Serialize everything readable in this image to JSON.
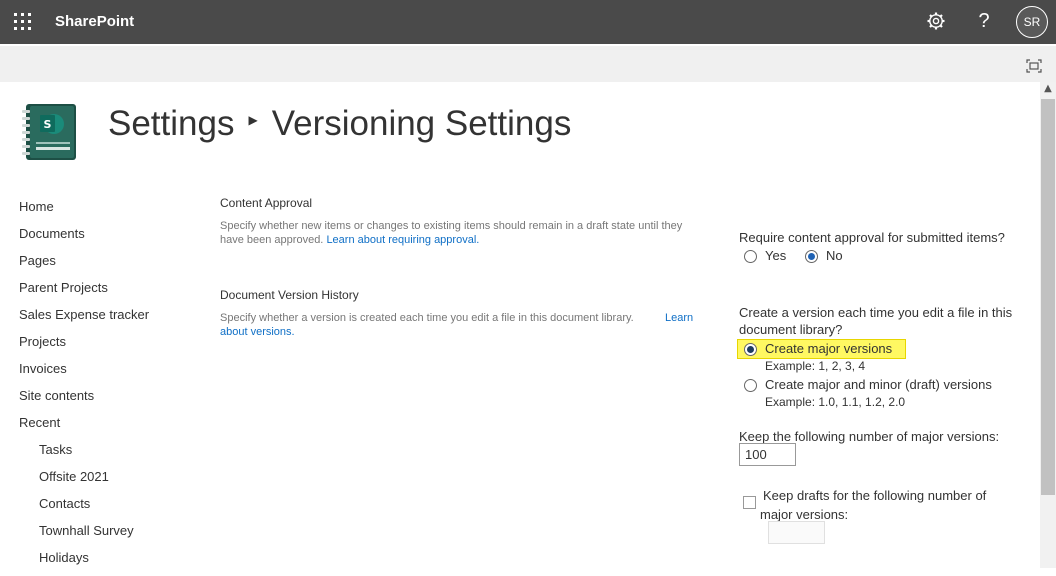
{
  "suite": {
    "brand": "SharePoint",
    "help_glyph": "?",
    "avatar_initials": "SR",
    "bar_color": "#4a4a4a"
  },
  "header": {
    "crumb_root": "Settings",
    "crumb_current": "Versioning Settings",
    "logo_icon": "sharepoint-diary-logo"
  },
  "leftnav": {
    "items": [
      {
        "label": "Home"
      },
      {
        "label": "Documents"
      },
      {
        "label": "Pages"
      },
      {
        "label": "Parent Projects"
      },
      {
        "label": "Sales Expense tracker"
      },
      {
        "label": "Projects"
      },
      {
        "label": "Invoices"
      },
      {
        "label": "Site contents"
      },
      {
        "label": "Recent"
      }
    ],
    "recent": [
      {
        "label": "Tasks"
      },
      {
        "label": "Offsite 2021"
      },
      {
        "label": "Contacts"
      },
      {
        "label": "Townhall Survey"
      },
      {
        "label": "Holidays"
      }
    ]
  },
  "content_approval": {
    "title": "Content Approval",
    "description": "Specify whether new items or changes to existing items should remain in a draft state until they have been approved.",
    "link": "Learn about requiring approval.",
    "question": "Require content approval for submitted items?",
    "yes_label": "Yes",
    "no_label": "No",
    "selected": "No"
  },
  "version_history": {
    "title": "Document Version History",
    "description": "Specify whether a version is created each time you edit a file in this document library.",
    "link_line1": "Learn",
    "link_line2": "about versions.",
    "question_line1": "Create a version each time you edit a file in this",
    "question_line2": "document library?",
    "option_major": "Create major versions",
    "option_major_example": "Example: 1, 2, 3, 4",
    "option_minor": "Create major and minor (draft) versions",
    "option_minor_example": "Example: 1.0, 1.1, 1.2, 2.0",
    "selected": "Create major versions",
    "keep_major_label": "Keep the following number of major versions:",
    "keep_major_value": "100",
    "keep_drafts_line1": "Keep drafts for the following number of",
    "keep_drafts_line2": "major versions:",
    "keep_drafts_checked": false,
    "keep_drafts_value": ""
  },
  "colors": {
    "link": "#0f6fc6",
    "highlight": "#fff862",
    "radio_selected": "#1f62b4"
  }
}
